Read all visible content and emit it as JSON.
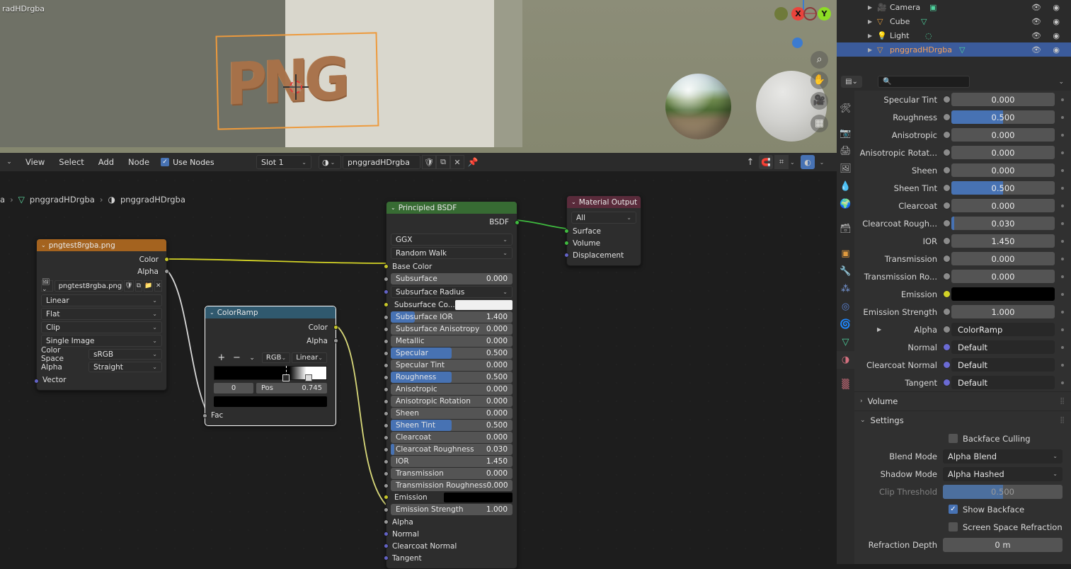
{
  "viewport": {
    "object_label": "radHDrgba",
    "mesh_text": "PNG",
    "gizmo": {
      "x": "X",
      "y": "Y"
    },
    "buttons": [
      {
        "name": "zoom-icon",
        "glyph": "⌕"
      },
      {
        "name": "pan-hand-icon",
        "glyph": "✋"
      },
      {
        "name": "camera-view-icon",
        "glyph": "🎥"
      },
      {
        "name": "ortho-persp-icon",
        "glyph": "▦"
      }
    ]
  },
  "node_editor": {
    "header": {
      "editor_type": "shader-editor",
      "menus": [
        "View",
        "Select",
        "Add",
        "Node"
      ],
      "use_nodes_label": "Use Nodes",
      "use_nodes_checked": true,
      "slot": "Slot 1",
      "material_name": "pnggradHDrgba",
      "fake_user_icon": "shield-icon",
      "new_material_icon": "copy-icon",
      "unlink_icon": "x-icon",
      "pin_icon": "pin-icon",
      "snap_label": "",
      "overlay_on": true
    },
    "breadcrumb": [
      "a",
      "pnggradHDrgba",
      "pnggradHDrgba"
    ],
    "nodes": {
      "image_texture": {
        "title": "pngtest8rgba.png",
        "header_color": "#a4631f",
        "outputs": [
          "Color",
          "Alpha"
        ],
        "image_name": "pngtest8rgba.png",
        "interpolation": "Linear",
        "projection": "Flat",
        "extension": "Clip",
        "source": "Single Image",
        "color_space_label": "Color Space",
        "color_space": "sRGB",
        "alpha_label": "Alpha",
        "alpha": "Straight",
        "inputs": [
          "Vector"
        ]
      },
      "color_ramp": {
        "title": "ColorRamp",
        "header_color": "#30596e",
        "selected": true,
        "outputs": [
          "Color",
          "Alpha"
        ],
        "add_label": "+",
        "remove_label": "−",
        "color_mode": "RGB",
        "interpolation": "Linear",
        "index": "0",
        "pos_label": "Pos",
        "pos_value": "0.745",
        "inputs": [
          "Fac"
        ]
      },
      "principled_bsdf": {
        "title": "Principled BSDF",
        "header_color": "#376b33",
        "output": "BSDF",
        "distribution": "GGX",
        "subsurface_method": "Random Walk",
        "sockets": [
          {
            "label": "Base Color",
            "type": "color-link",
            "socket": "yellow"
          },
          {
            "label": "Subsurface",
            "value": "0.000",
            "socket": "gray",
            "fill": 0
          },
          {
            "label": "Subsurface Radius",
            "type": "dropdown",
            "socket": "purple"
          },
          {
            "label": "Subsurface Co...",
            "type": "swatch",
            "swatch": "#f0f0f0",
            "socket": "yellow"
          },
          {
            "label": "Subsurface IOR",
            "value": "1.400",
            "socket": "gray",
            "fill": 20
          },
          {
            "label": "Subsurface Anisotropy",
            "value": "0.000",
            "socket": "gray",
            "fill": 0
          },
          {
            "label": "Metallic",
            "value": "0.000",
            "socket": "gray",
            "fill": 0
          },
          {
            "label": "Specular",
            "value": "0.500",
            "socket": "gray",
            "fill": 50
          },
          {
            "label": "Specular Tint",
            "value": "0.000",
            "socket": "gray",
            "fill": 0
          },
          {
            "label": "Roughness",
            "value": "0.500",
            "socket": "gray",
            "fill": 50
          },
          {
            "label": "Anisotropic",
            "value": "0.000",
            "socket": "gray",
            "fill": 0
          },
          {
            "label": "Anisotropic Rotation",
            "value": "0.000",
            "socket": "gray",
            "fill": 0
          },
          {
            "label": "Sheen",
            "value": "0.000",
            "socket": "gray",
            "fill": 0
          },
          {
            "label": "Sheen Tint",
            "value": "0.500",
            "socket": "gray",
            "fill": 50
          },
          {
            "label": "Clearcoat",
            "value": "0.000",
            "socket": "gray",
            "fill": 0
          },
          {
            "label": "Clearcoat Roughness",
            "value": "0.030",
            "socket": "gray",
            "fill": 3
          },
          {
            "label": "IOR",
            "value": "1.450",
            "socket": "gray",
            "fill": 0
          },
          {
            "label": "Transmission",
            "value": "0.000",
            "socket": "gray",
            "fill": 0
          },
          {
            "label": "Transmission Roughness",
            "value": "0.000",
            "socket": "gray",
            "fill": 0
          },
          {
            "label": "Emission",
            "type": "swatch",
            "swatch": "#000000",
            "socket": "yellow"
          },
          {
            "label": "Emission Strength",
            "value": "1.000",
            "socket": "gray",
            "fill": 0
          },
          {
            "label": "Alpha",
            "type": "linked",
            "socket": "gray"
          },
          {
            "label": "Normal",
            "type": "linked",
            "socket": "purple"
          },
          {
            "label": "Clearcoat Normal",
            "type": "linked",
            "socket": "purple"
          },
          {
            "label": "Tangent",
            "type": "linked",
            "socket": "purple"
          }
        ]
      },
      "material_output": {
        "title": "Material Output",
        "header_color": "#5a2b3b",
        "target": "All",
        "inputs": [
          {
            "label": "Surface",
            "socket": "green"
          },
          {
            "label": "Volume",
            "socket": "green"
          },
          {
            "label": "Displacement",
            "socket": "purple"
          }
        ]
      }
    }
  },
  "outliner": {
    "rows": [
      {
        "name": "Camera",
        "icon": "camera-icon",
        "data_icon": "camera-data-icon",
        "selected": false
      },
      {
        "name": "Cube",
        "icon": "mesh-icon",
        "data_icon": "mesh-data-icon",
        "selected": false
      },
      {
        "name": "Light",
        "icon": "light-icon",
        "data_icon": "light-data-icon",
        "selected": false
      },
      {
        "name": "pnggradHDrgba",
        "icon": "mesh-icon",
        "data_icon": "mesh-data-icon",
        "selected": true
      }
    ]
  },
  "properties": {
    "search_placeholder": "",
    "tabs": [
      {
        "name": "tool",
        "glyph": "🛠",
        "active": false
      },
      {
        "name": "render",
        "glyph": "📷",
        "active": false
      },
      {
        "name": "output",
        "glyph": "🖨",
        "active": false
      },
      {
        "name": "view-layer",
        "glyph": "🖼",
        "active": false
      },
      {
        "name": "scene",
        "glyph": "💧",
        "active": false
      },
      {
        "name": "world",
        "glyph": "🌍",
        "active": false
      },
      {
        "name": "collection",
        "glyph": "🗃",
        "active": false
      },
      {
        "name": "object",
        "glyph": "▣",
        "active": false
      },
      {
        "name": "modifier",
        "glyph": "🔧",
        "active": false
      },
      {
        "name": "particles",
        "glyph": "⁂",
        "active": false
      },
      {
        "name": "physics",
        "glyph": "◎",
        "active": false
      },
      {
        "name": "constraints",
        "glyph": "🌀",
        "active": false
      },
      {
        "name": "data",
        "glyph": "▽",
        "active": false
      },
      {
        "name": "material",
        "glyph": "◑",
        "active": true
      },
      {
        "name": "texture",
        "glyph": "▒",
        "active": false
      }
    ],
    "rows": [
      {
        "label": "Specular Tint",
        "value": "0.000",
        "fill": 0,
        "socket": "gray"
      },
      {
        "label": "Roughness",
        "value": "0.500",
        "fill": 50,
        "socket": "gray"
      },
      {
        "label": "Anisotropic",
        "value": "0.000",
        "fill": 0,
        "socket": "gray"
      },
      {
        "label": "Anisotropic Rotat...",
        "value": "0.000",
        "fill": 0,
        "socket": "gray"
      },
      {
        "label": "Sheen",
        "value": "0.000",
        "fill": 0,
        "socket": "gray"
      },
      {
        "label": "Sheen Tint",
        "value": "0.500",
        "fill": 50,
        "socket": "gray"
      },
      {
        "label": "Clearcoat",
        "value": "0.000",
        "fill": 0,
        "socket": "gray"
      },
      {
        "label": "Clearcoat Rough...",
        "value": "0.030",
        "fill": 3,
        "socket": "gray"
      },
      {
        "label": "IOR",
        "value": "1.450",
        "fill": 0,
        "socket": "gray"
      },
      {
        "label": "Transmission",
        "value": "0.000",
        "fill": 0,
        "socket": "gray"
      },
      {
        "label": "Transmission Ro...",
        "value": "0.000",
        "fill": 0,
        "socket": "gray"
      },
      {
        "label": "Emission",
        "value": "",
        "swatch": "#000000",
        "socket": "yellow"
      },
      {
        "label": "Emission Strength",
        "value": "1.000",
        "fill": 0,
        "socket": "gray"
      },
      {
        "label": "Alpha",
        "value": "ColorRamp",
        "linked": true,
        "expand": true,
        "socket": "gray"
      },
      {
        "label": "Normal",
        "value": "Default",
        "linked": true,
        "socket": "purple"
      },
      {
        "label": "Clearcoat Normal",
        "value": "Default",
        "linked": true,
        "socket": "purple"
      },
      {
        "label": "Tangent",
        "value": "Default",
        "linked": true,
        "socket": "purple"
      }
    ],
    "volume_panel": {
      "title": "Volume",
      "expanded": false
    },
    "settings_panel": {
      "title": "Settings",
      "expanded": true,
      "backface_culling": {
        "label": "Backface Culling",
        "checked": false
      },
      "blend_mode": {
        "label": "Blend Mode",
        "value": "Alpha Blend"
      },
      "shadow_mode": {
        "label": "Shadow Mode",
        "value": "Alpha Hashed"
      },
      "clip_threshold": {
        "label": "Clip Threshold",
        "value": "0.500",
        "fill": 50
      },
      "show_backface": {
        "label": "Show Backface",
        "checked": true
      },
      "screen_space_refraction": {
        "label": "Screen Space Refraction",
        "checked": false
      },
      "refraction_depth": {
        "label": "Refraction Depth",
        "value": "0 m"
      }
    }
  }
}
